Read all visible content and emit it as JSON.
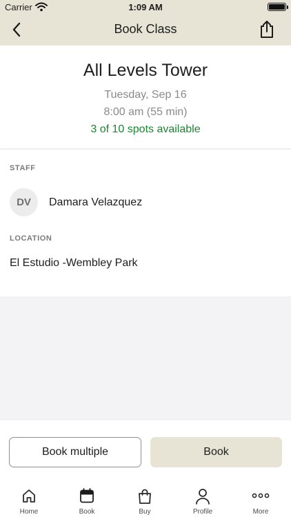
{
  "status_bar": {
    "carrier": "Carrier",
    "time": "1:09 AM"
  },
  "nav": {
    "title": "Book Class",
    "back_icon": "chevron-left-icon",
    "share_icon": "share-icon"
  },
  "class_info": {
    "name": "All Levels Tower",
    "date": "Tuesday, Sep 16",
    "time": "8:00 am (55 min)",
    "spots": "3 of 10 spots available"
  },
  "staff": {
    "label": "STAFF",
    "initials": "DV",
    "name": "Damara Velazquez"
  },
  "location": {
    "label": "LOCATION",
    "name": "El Estudio -Wembley Park"
  },
  "actions": {
    "book_multiple": "Book multiple",
    "book": "Book"
  },
  "tabs": [
    {
      "label": "Home",
      "icon": "home-icon"
    },
    {
      "label": "Book",
      "icon": "calendar-icon"
    },
    {
      "label": "Buy",
      "icon": "shopping-bag-icon"
    },
    {
      "label": "Profile",
      "icon": "person-icon"
    },
    {
      "label": "More",
      "icon": "more-dots-icon"
    }
  ],
  "colors": {
    "header_background": "#e7e4d6",
    "primary_button": "#e7e4d6",
    "spots_available": "#19872f",
    "secondary_text": "#8a8a8a",
    "empty_area": "#f3f3f5"
  }
}
